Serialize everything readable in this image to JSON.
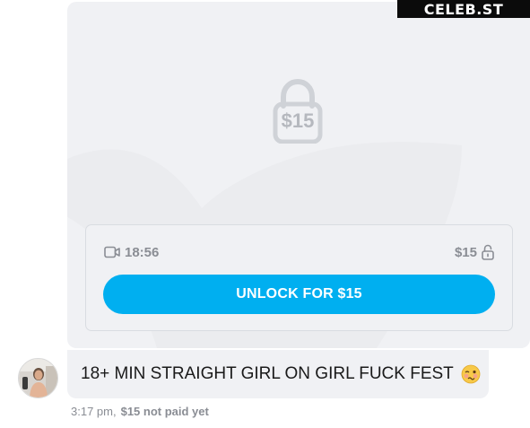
{
  "watermark": "CELEB.ST",
  "media": {
    "lock_price": "$15",
    "duration": "18:56",
    "price": "$15",
    "unlock_label": "UNLOCK FOR $15"
  },
  "message": {
    "text": "18+ MIN STRAIGHT GIRL ON GIRL FUCK FEST",
    "time": "3:17 pm,",
    "status": "$15 not paid yet"
  },
  "icons": {
    "watermark": "logo-text",
    "lock_big": "lock-icon",
    "video": "video-icon",
    "price_lock": "lock-open-icon",
    "emoji": "woozy-face-emoji"
  },
  "colors": {
    "accent": "#00aff0",
    "card_bg": "#f0f1f4",
    "muted_text": "#8a8d94"
  }
}
